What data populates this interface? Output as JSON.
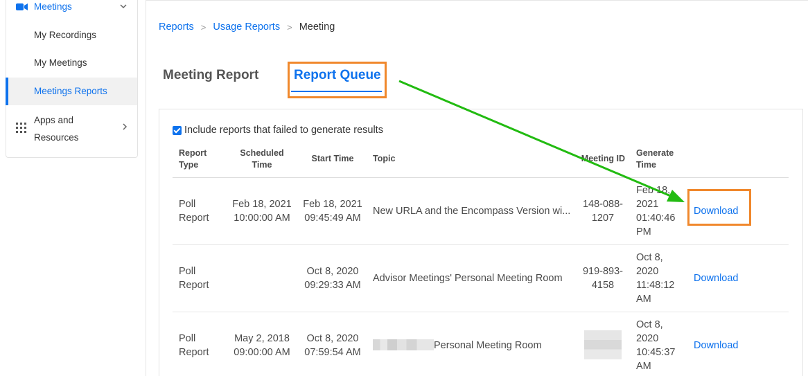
{
  "sidebar": {
    "meetings_label": "Meetings",
    "items": [
      {
        "label": "My Recordings"
      },
      {
        "label": "My Meetings"
      },
      {
        "label": "Meetings Reports"
      }
    ],
    "apps_label_line1": "Apps and",
    "apps_label_line2": "Resources"
  },
  "breadcrumb": {
    "reports": "Reports",
    "usage_reports": "Usage Reports",
    "current": "Meeting"
  },
  "tabs": {
    "meeting_report": "Meeting Report",
    "report_queue": "Report Queue"
  },
  "filter": {
    "include_failed_label": "Include reports that failed to generate results",
    "checked": true
  },
  "table": {
    "headers": {
      "report_type_1": "Report",
      "report_type_2": "Type",
      "scheduled_1": "Scheduled",
      "scheduled_2": "Time",
      "start_time": "Start Time",
      "topic": "Topic",
      "meeting_id": "Meeting ID",
      "generate_1": "Generate",
      "generate_2": "Time"
    },
    "rows": [
      {
        "type_1": "Poll",
        "type_2": "Report",
        "sched_1": "Feb 18, 2021",
        "sched_2": "10:00:00 AM",
        "start_1": "Feb 18, 2021",
        "start_2": "09:45:49 AM",
        "topic": "New URLA and the Encompass Version wi...",
        "mid_1": "148-088-",
        "mid_2": "1207",
        "gen_1": "Feb 18,",
        "gen_2": "2021",
        "gen_3": "01:40:46",
        "gen_4": "PM",
        "action": "Download"
      },
      {
        "type_1": "Poll",
        "type_2": "Report",
        "sched_1": "",
        "sched_2": "",
        "start_1": "Oct 8, 2020",
        "start_2": "09:29:33 AM",
        "topic": "Advisor Meetings' Personal Meeting Room",
        "mid_1": "919-893-",
        "mid_2": "4158",
        "gen_1": "Oct 8,",
        "gen_2": "2020",
        "gen_3": "11:48:12",
        "gen_4": "AM",
        "action": "Download"
      },
      {
        "type_1": "Poll",
        "type_2": "Report",
        "sched_1": "May 2, 2018",
        "sched_2": "09:00:00 AM",
        "start_1": "Oct 8, 2020",
        "start_2": "07:59:54 AM",
        "topic": "Personal Meeting Room",
        "mid_1": "",
        "mid_2": "",
        "gen_1": "Oct 8,",
        "gen_2": "2020",
        "gen_3": "10:45:37",
        "gen_4": "AM",
        "action": "Download"
      }
    ]
  },
  "colors": {
    "accent": "#0e72ed",
    "highlight": "#f0882c",
    "arrow": "#22bb11"
  }
}
